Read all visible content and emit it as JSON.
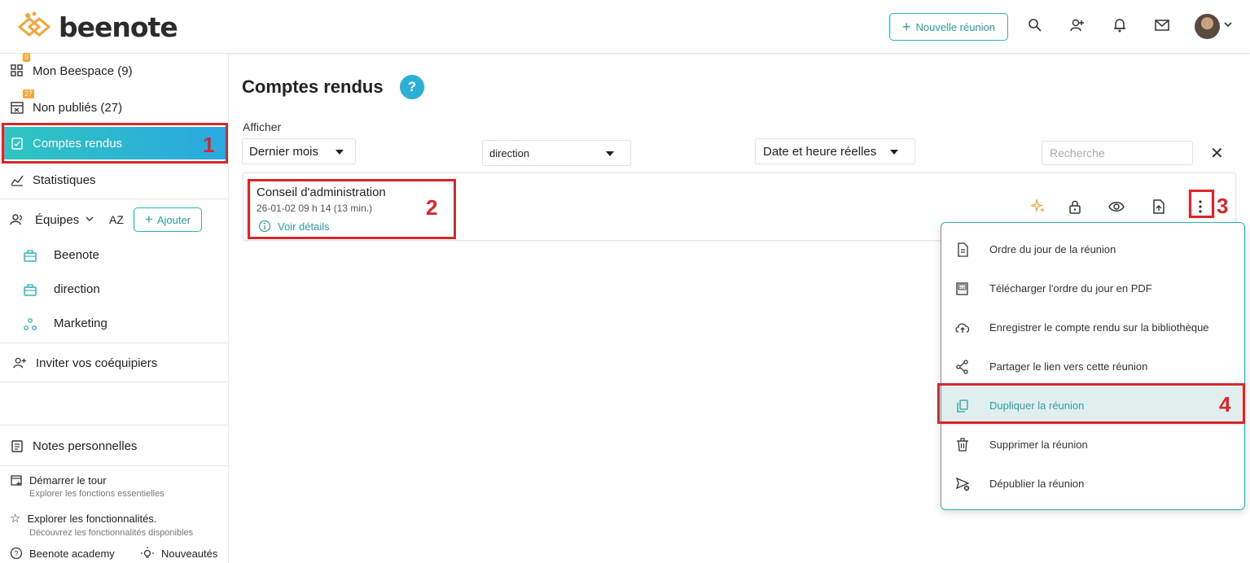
{
  "app": {
    "logo_text": "beenote",
    "new_meeting_label": "Nouvelle réunion",
    "icons": [
      "search-icon",
      "add-user-icon",
      "bell-icon",
      "mail-icon",
      "avatar",
      "chevron-down-icon"
    ]
  },
  "sidebar": {
    "items": [
      {
        "label": "Mon Beespace (9)",
        "badge": "9"
      },
      {
        "label": "Non publiés (27)",
        "badge": "27"
      },
      {
        "label": "Comptes rendus"
      },
      {
        "label": "Statistiques"
      }
    ],
    "teams_label": "Équipes",
    "sort_label": "AZ",
    "add_label": "Ajouter",
    "teams": [
      "Beenote",
      "direction",
      "Marketing"
    ],
    "invite_label": "Inviter vos coéquipiers",
    "notes_label": "Notes personnelles",
    "tour_label": "Démarrer le tour",
    "tour_sub": "Explorer les fonctions essentielles",
    "explore_label": "Explorer les fonctionnalités.",
    "explore_sub": "Découvrez les fonctionnalités disponibles",
    "academy_label": "Beenote academy",
    "news_label": "Nouveautés"
  },
  "main": {
    "title": "Comptes rendus",
    "help_label": "?",
    "filter_label": "Afficher",
    "period_select": "Dernier mois",
    "team_select": "direction",
    "date_select": "Date et heure réelles",
    "search_placeholder": "Recherche",
    "clear_label": "✕",
    "meeting": {
      "title": "Conseil d'administration",
      "date": "26-01-02 09 h 14 (13 min.)",
      "details_label": "Voir détails"
    }
  },
  "menu": {
    "items": [
      "Ordre du jour de la réunion",
      "Télécharger l'ordre du jour en PDF",
      "Enregistrer le compte rendu sur la bibliothèque",
      "Partager le lien vers cette réunion",
      "Dupliquer la réunion",
      "Supprimer la réunion",
      "Dépublier la réunion"
    ],
    "highlighted": "Dupliquer la réunion"
  },
  "annotations": [
    "1",
    "2",
    "3",
    "4"
  ],
  "colors": {
    "accent": "#2bb5b0",
    "active_gradient_start": "#2ec5c0",
    "active_gradient_end": "#2aa8e0",
    "annotation_red": "#d8262b",
    "badge_orange": "#f2a53a"
  }
}
